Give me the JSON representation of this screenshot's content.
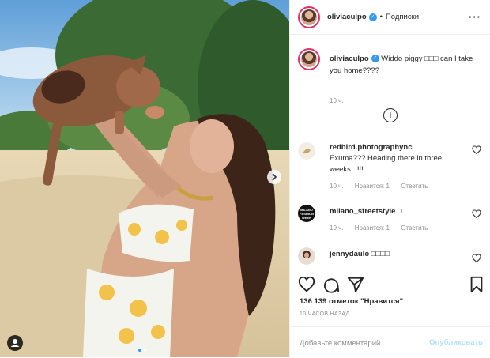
{
  "post": {
    "username": "oliviaculpo",
    "follow_label": "Подписки",
    "caption": {
      "username": "oliviaculpo",
      "text": "Widdo piggy □□□ can I take you home????",
      "time": "10 ч."
    },
    "comments": [
      {
        "username": "redbird.photographync",
        "text": "Exuma??? Heading there in three weeks. !!!!",
        "time": "10 ч.",
        "likes": "Нравится: 1",
        "reply": "Ответить"
      },
      {
        "username": "milano_streetstyle",
        "text": "□",
        "avatar_text": "MILANO FASHION WEEK",
        "time": "10 ч.",
        "likes": "Нравится: 1",
        "reply": "Ответить"
      },
      {
        "username": "jennydaulo",
        "text": "□□□□"
      }
    ],
    "likes_text": "136 139 отметок \"Нравится\"",
    "posted_ago": "10 ЧАСОВ НАЗАД",
    "comment_placeholder": "Добавьте комментарий...",
    "publish_label": "Опубликовать"
  },
  "carousel": {
    "slides": 2,
    "active": 1
  },
  "colors": {
    "verified": "#3897f0",
    "publish_disabled": "#b2dffc",
    "muted": "#8e8e8e"
  },
  "icons": [
    "more-options-icon",
    "load-more-icon",
    "heart-icon",
    "comment-icon",
    "share-icon",
    "bookmark-icon",
    "user-tag-icon",
    "next-arrow-icon",
    "verified-icon"
  ]
}
